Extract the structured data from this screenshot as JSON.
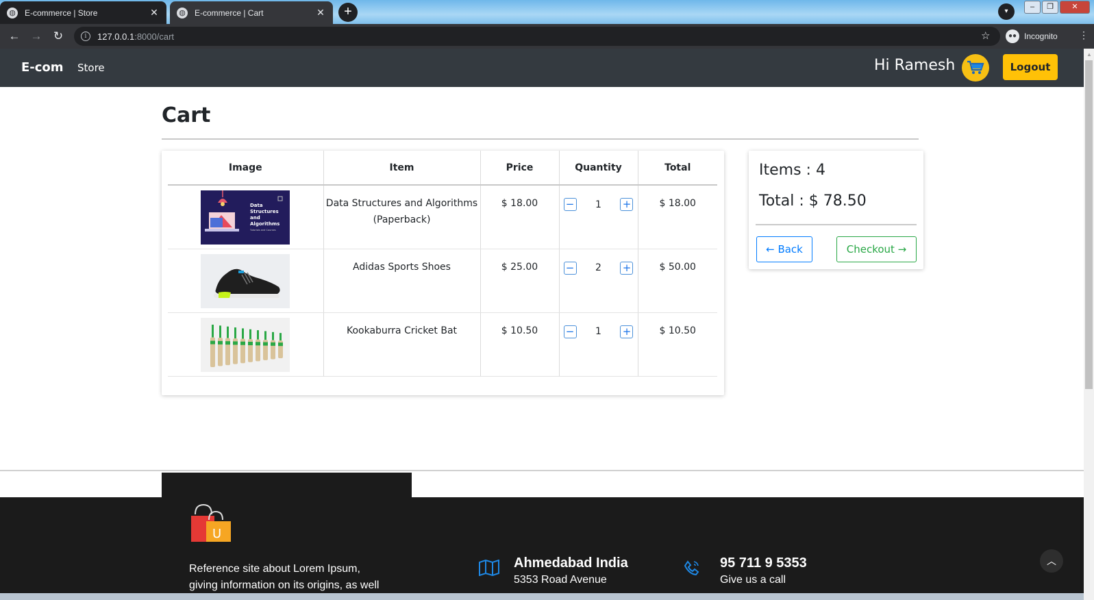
{
  "browser": {
    "tabs": [
      {
        "title": "E-commerce | Store",
        "active": false
      },
      {
        "title": "E-commerce | Cart",
        "active": true
      }
    ],
    "url_host": "127.0.0.1",
    "url_rest": ":8000/cart",
    "incognito_label": "Incognito"
  },
  "navbar": {
    "brand": "E-com",
    "store_link": "Store",
    "greeting": "Hi Ramesh",
    "logout_label": "Logout"
  },
  "page": {
    "title": "Cart"
  },
  "cart": {
    "headers": [
      "Image",
      "Item",
      "Price",
      "Quantity",
      "Total"
    ],
    "rows": [
      {
        "item": "Data Structures and Algorithms (Paperback)",
        "price": "$ 18.00",
        "quantity": "1",
        "total": "$ 18.00",
        "image_icon": "book-cover-image"
      },
      {
        "item": "Adidas Sports Shoes",
        "price": "$ 25.00",
        "quantity": "2",
        "total": "$ 50.00",
        "image_icon": "shoe-image"
      },
      {
        "item": "Kookaburra Cricket Bat",
        "price": "$ 10.50",
        "quantity": "1",
        "total": "$ 10.50",
        "image_icon": "cricket-bats-image"
      }
    ],
    "book_cover_text": "Data Structures and Algorithms",
    "book_cover_subtext": "Tutorials and Courses"
  },
  "summary": {
    "items_text": "Items : 4",
    "total_text": "Total : $ 78.50",
    "back_label": "← Back",
    "checkout_label": "Checkout →"
  },
  "footer": {
    "about_line1": "Reference site about Lorem Ipsum,",
    "about_line2": "giving information on its origins, as well",
    "location_title": "Ahmedabad India",
    "location_sub": "5353 Road Avenue",
    "phone_title": "95 711 9 5353",
    "phone_sub": "Give us a call"
  },
  "colors": {
    "navbar_bg": "#343a40",
    "accent_yellow": "#ffc107",
    "primary_blue": "#007bff",
    "success_green": "#28a745",
    "footer_bg": "#1b1b1b"
  }
}
